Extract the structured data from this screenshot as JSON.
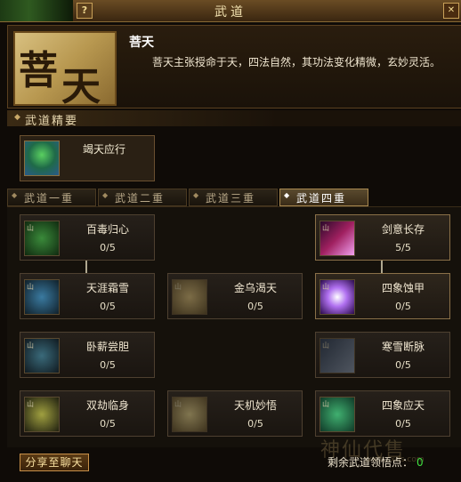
{
  "window": {
    "title": "武道",
    "help_label": "?",
    "close_label": "✕"
  },
  "style": {
    "name": "菩天",
    "emblem_text": "菩天",
    "description": "菩天主张授命于天，四法自然，其功法变化精微，玄妙灵活。"
  },
  "section": {
    "label": "武道精要"
  },
  "essence": {
    "name": "竭天应行"
  },
  "tabs": [
    {
      "label": "武道一重",
      "active": false
    },
    {
      "label": "武道二重",
      "active": false
    },
    {
      "label": "武道三重",
      "active": false
    },
    {
      "label": "武道四重",
      "active": true
    }
  ],
  "skills": [
    {
      "name": "百毒归心",
      "points": "0/5",
      "lit": false
    },
    {
      "name": "剑意长存",
      "points": "5/5",
      "lit": true
    },
    {
      "name": "天涯霜雪",
      "points": "0/5",
      "lit": false
    },
    {
      "name": "金乌渴天",
      "points": "0/5",
      "lit": false
    },
    {
      "name": "四象蚀甲",
      "points": "0/5",
      "lit": true
    },
    {
      "name": "卧薪尝胆",
      "points": "0/5",
      "lit": false
    },
    {
      "name": "寒雪断脉",
      "points": "0/5",
      "lit": false
    },
    {
      "name": "双劫临身",
      "points": "0/5",
      "lit": false
    },
    {
      "name": "天机妙悟",
      "points": "0/5",
      "lit": false
    },
    {
      "name": "四象应天",
      "points": "0/5",
      "lit": false
    }
  ],
  "footer": {
    "share_label": "分享至聊天",
    "remaining_label": "剩余武道领悟点：",
    "remaining_value": "0"
  },
  "watermark": {
    "text": "神仙代售",
    "url": "www.sxds.com"
  },
  "colors": {
    "accent": "#c89048",
    "points_value": "#40e040",
    "lit_border": "#8a7048"
  }
}
